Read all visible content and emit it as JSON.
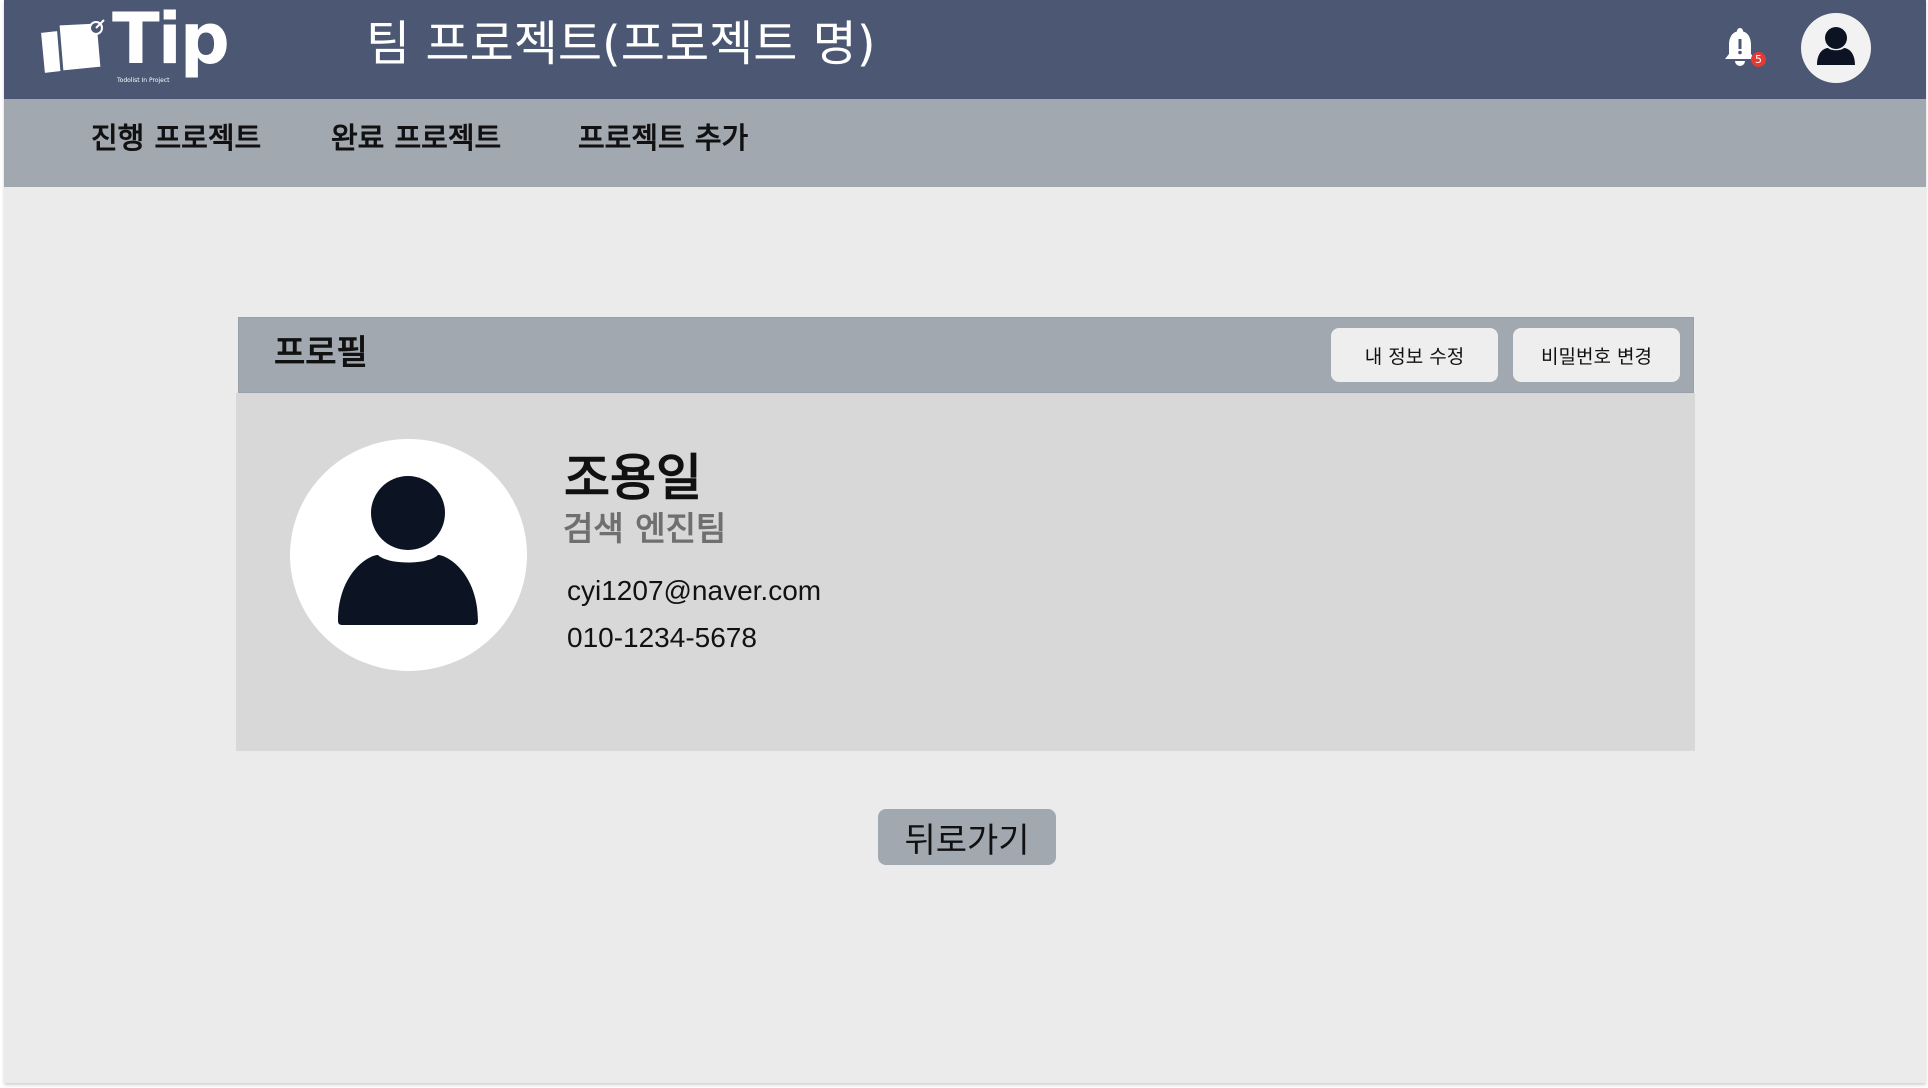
{
  "app": {
    "logo_text": "Tip",
    "logo_subtitle": "Todolist In Project",
    "page_title": "팀 프로젝트(프로젝트 명)",
    "notification_count": "5",
    "colors": {
      "header": "#4b5773",
      "nav": "#a2a8b0",
      "page_background": "#eaebea",
      "card_body": "#d8d8d8",
      "badge": "#e53935"
    }
  },
  "nav": {
    "items": [
      {
        "label": "진행 프로젝트"
      },
      {
        "label": "완료 프로젝트"
      },
      {
        "label": "프로젝트 추가"
      }
    ]
  },
  "profile": {
    "title": "프로필",
    "edit_button": "내 정보 수정",
    "password_button": "비밀번호 변경",
    "name": "조용일",
    "team": "검색 엔진팀",
    "email": "cyi1207@naver.com",
    "phone": "010-1234-5678"
  },
  "actions": {
    "back_label": "뒤로가기"
  },
  "icons": {
    "logo": "sticky-notes-icon",
    "notification": "bell-icon",
    "user": "user-icon"
  }
}
